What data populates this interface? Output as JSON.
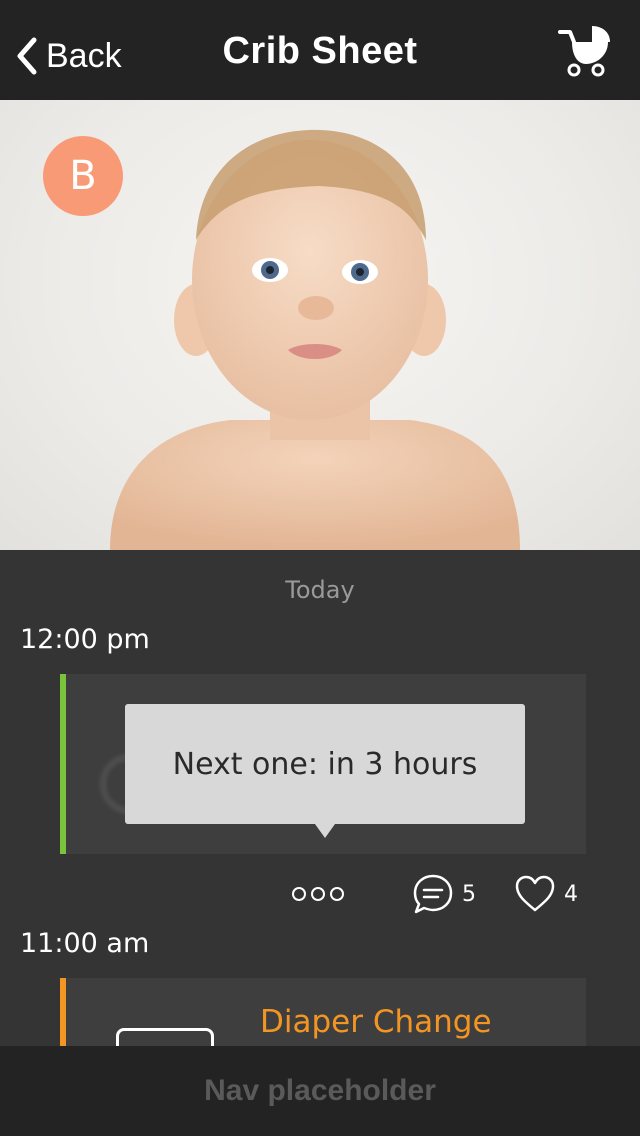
{
  "header": {
    "back_label": "Back",
    "title": "Crib Sheet",
    "cart_icon": "stroller-icon"
  },
  "profile": {
    "badge_letter": "B",
    "badge_color": "#f99a77"
  },
  "feed": {
    "day_label": "Today",
    "entries": [
      {
        "time": "12:00 pm",
        "accent": "#7ac43c",
        "tooltip": "Next one: in 3 hours",
        "comments": "5",
        "likes": "4"
      },
      {
        "time": "11:00 am",
        "accent": "#f39522",
        "title": "Diaper Change"
      }
    ]
  },
  "nav": {
    "label": "Nav placeholder"
  }
}
